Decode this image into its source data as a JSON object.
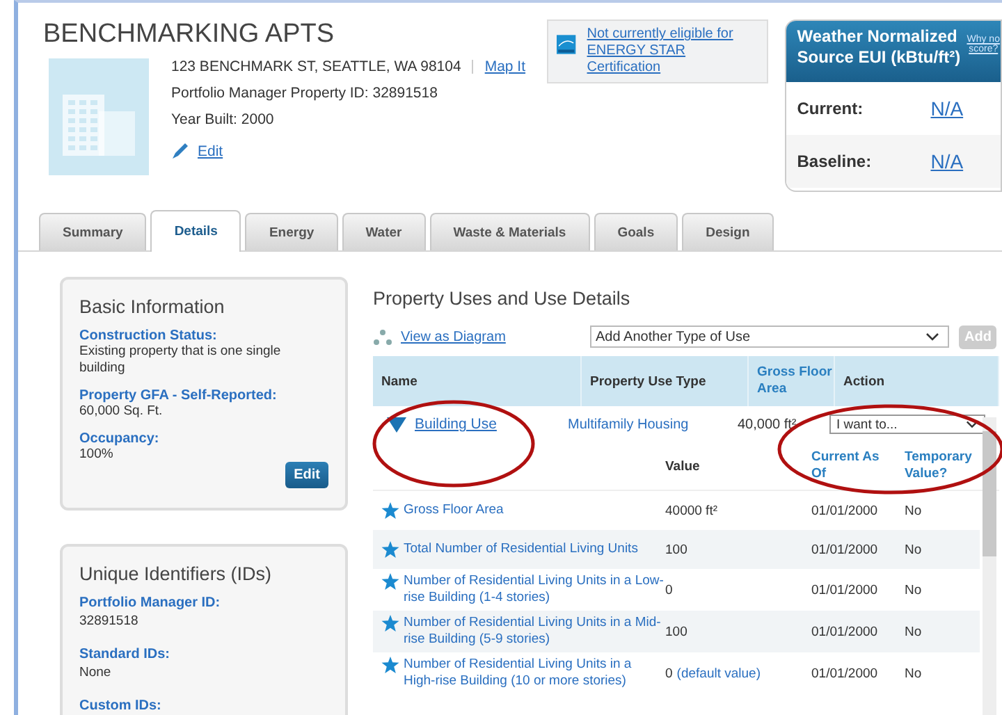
{
  "property": {
    "name": "BENCHMARKING APTS",
    "address": "123 BENCHMARK ST, SEATTLE, WA 98104",
    "map_link": "Map It",
    "pm_id": "Portfolio Manager Property ID: 32891518",
    "year_built": "Year Built: 2000",
    "edit": "Edit"
  },
  "energy_star": {
    "text": "Not currently eligible for ENERGY STAR Certification"
  },
  "eui_panel": {
    "title": "Weather Normalized Source EUI (kBtu/ft²)",
    "why_link": [
      "Why no",
      "score?"
    ],
    "rows": [
      {
        "label": "Current:",
        "value": "N/A"
      },
      {
        "label": "Baseline:",
        "value": "N/A"
      }
    ]
  },
  "tabs": [
    {
      "label": "Summary",
      "selected": false
    },
    {
      "label": "Details",
      "selected": true
    },
    {
      "label": "Energy",
      "selected": false
    },
    {
      "label": "Water",
      "selected": false
    },
    {
      "label": "Waste & Materials",
      "selected": false
    },
    {
      "label": "Goals",
      "selected": false
    },
    {
      "label": "Design",
      "selected": false
    }
  ],
  "basic_info": {
    "title": "Basic Information",
    "fields": [
      {
        "label": "Construction Status:",
        "value": "Existing property that is one single building"
      },
      {
        "label": "Property GFA - Self-Reported:",
        "value": "60,000 Sq. Ft."
      },
      {
        "label": "Occupancy:",
        "value": "100%"
      }
    ],
    "edit_button": "Edit"
  },
  "unique_ids": {
    "title": "Unique Identifiers (IDs)",
    "fields": [
      {
        "label": "Portfolio Manager ID:",
        "value": "32891518"
      },
      {
        "label": "Standard IDs:",
        "value": "None"
      },
      {
        "label": "Custom IDs:"
      }
    ]
  },
  "uses": {
    "title": "Property Uses and Use Details",
    "diagram_link": "View as Diagram",
    "add_select": "Add Another Type of Use",
    "add_button": "Add",
    "add_disabled": true,
    "columns": [
      "Name",
      "Property Use Type",
      "Gross Floor Area",
      "Action"
    ],
    "use": {
      "name": "Building Use",
      "expanded": true,
      "type": "Multifamily Housing",
      "gfa": "40,000 ft²",
      "action": "I want to..."
    },
    "detail_columns": [
      "Value",
      "Current As Of",
      "Temporary Value?"
    ],
    "details": [
      {
        "name": "Gross Floor Area",
        "value": "40000 ft²",
        "date": "01/01/2000",
        "temporary": "No"
      },
      {
        "name": "Total Number of Residential Living Units",
        "value": "100",
        "date": "01/01/2000",
        "temporary": "No"
      },
      {
        "name": "Number of Residential Living Units in a Low-rise Building (1-4 stories)",
        "value": "0",
        "date": "01/01/2000",
        "temporary": "No"
      },
      {
        "name": "Number of Residential Living Units in a Mid-rise Building (5-9 stories)",
        "value": "100",
        "date": "01/01/2000",
        "temporary": "No"
      },
      {
        "name": "Number of Residential Living Units in a High-rise Building (10 or more stories)",
        "value": "0",
        "value_note": "(default value)",
        "date": "01/01/2000",
        "temporary": "No"
      }
    ]
  }
}
